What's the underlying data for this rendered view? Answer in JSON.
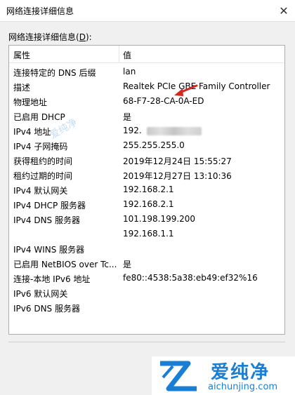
{
  "window": {
    "title": "网络连接详细信息",
    "close_glyph": "✕"
  },
  "details_label": {
    "prefix": "网络连接详细信息(",
    "accel": "D",
    "suffix": "):"
  },
  "table": {
    "columns": [
      "属性",
      "值"
    ],
    "rows": [
      {
        "prop": "连接特定的 DNS 后缀",
        "val": "lan"
      },
      {
        "prop": "描述",
        "val": "Realtek PCIe GBE Family Controller"
      },
      {
        "prop": "物理地址",
        "val": "68-F7-28-CA-0A-ED"
      },
      {
        "prop": "已启用 DHCP",
        "val": "是"
      },
      {
        "prop": "IPv4 地址",
        "val": "192."
      },
      {
        "prop": "IPv4 子网掩码",
        "val": "255.255.255.0"
      },
      {
        "prop": "获得租约的时间",
        "val": "2019年12月24日 15:55:27"
      },
      {
        "prop": "租约过期的时间",
        "val": "2019年12月27日 13:10:36"
      },
      {
        "prop": "IPv4 默认网关",
        "val": "192.168.2.1"
      },
      {
        "prop": "IPv4 DHCP 服务器",
        "val": "192.168.2.1"
      },
      {
        "prop": "IPv4 DNS 服务器",
        "val": "101.198.199.200"
      },
      {
        "prop": "",
        "val": "192.168.1.1"
      },
      {
        "prop": "IPv4 WINS 服务器",
        "val": ""
      },
      {
        "prop": "已启用 NetBIOS over Tc...",
        "val": "是"
      },
      {
        "prop": "连接-本地 IPv6 地址",
        "val": "fe80::4538:5a38:eb49:ef32%16"
      },
      {
        "prop": "IPv6 默认网关",
        "val": ""
      },
      {
        "prop": "IPv6 DNS 服务器",
        "val": ""
      }
    ]
  },
  "watermark": {
    "brand": "爱纯净",
    "domain": "aichunjing.com",
    "color": "#1a7fd4"
  },
  "colors": {
    "background": "#f0f0f0",
    "arrow": "#d9251d"
  }
}
